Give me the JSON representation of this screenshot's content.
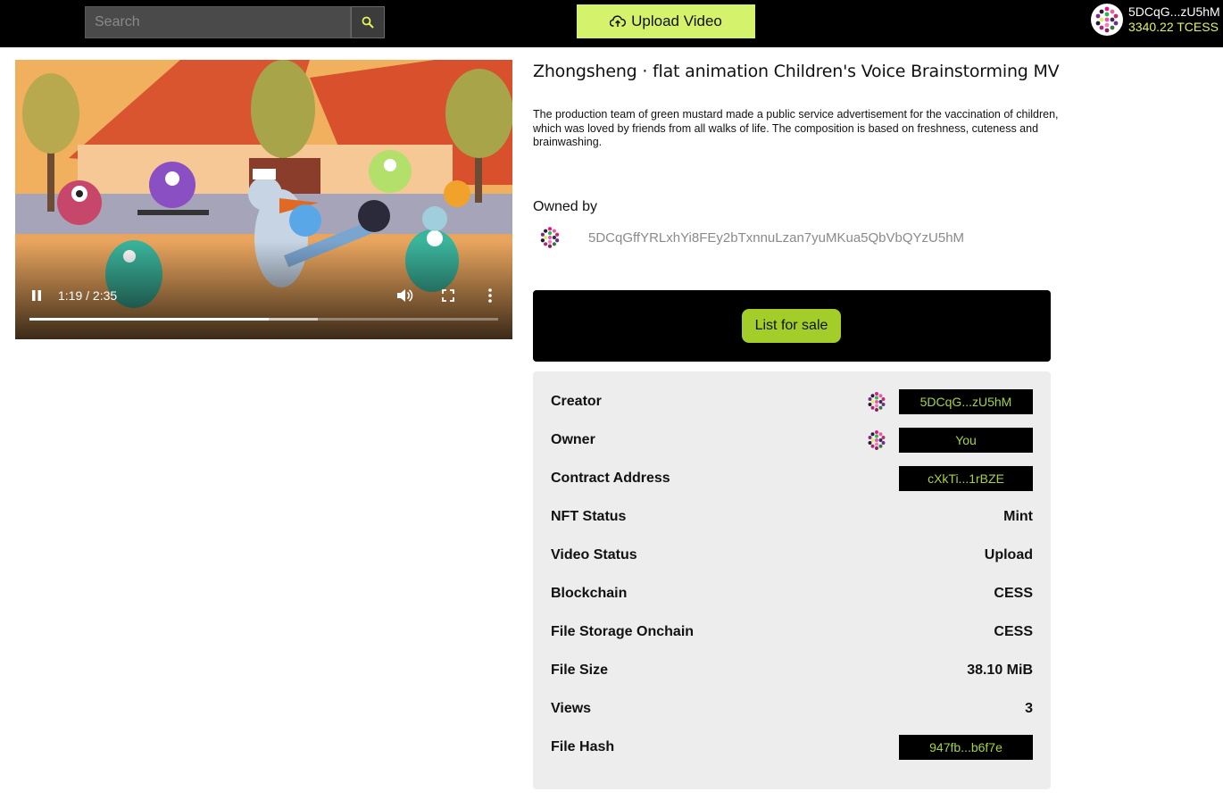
{
  "header": {
    "search_placeholder": "Search",
    "upload_label": "Upload Video",
    "account_address": "5DCqG...zU5hM",
    "account_balance": "3340.22 TCESS"
  },
  "video": {
    "time": "1:19 / 2:35",
    "progress_fraction": 0.51,
    "buffered_fraction": 0.615
  },
  "nft": {
    "title": "Zhongsheng · flat animation Children's Voice Brainstorming MV",
    "description": "The production team of green mustard made a public service advertisement for the vaccination of children, which was loved by friends from all walks of life. The composition is based on freshness, cuteness and brainwashing.",
    "owned_by_label": "Owned by",
    "owner_full_address": "5DCqGffYRLxhYi8FEy2bTxnnuLzan7yuMKua5QbVbQYzU5hM",
    "list_for_sale_label": "List for sale"
  },
  "details": [
    {
      "label": "Creator",
      "value": "5DCqG...zU5hM",
      "kind": "pill-avatar"
    },
    {
      "label": "Owner",
      "value": "You",
      "kind": "pill-avatar"
    },
    {
      "label": "Contract Address",
      "value": "cXkTi...1rBZE",
      "kind": "pill"
    },
    {
      "label": "NFT Status",
      "value": "Mint",
      "kind": "text"
    },
    {
      "label": "Video Status",
      "value": "Upload",
      "kind": "text"
    },
    {
      "label": "Blockchain",
      "value": "CESS",
      "kind": "text"
    },
    {
      "label": "File Storage Onchain",
      "value": "CESS",
      "kind": "text"
    },
    {
      "label": "File Size",
      "value": "38.10 MiB",
      "kind": "text"
    },
    {
      "label": "Views",
      "value": "3",
      "kind": "text"
    },
    {
      "label": "File Hash",
      "value": "947fb...b6f7e",
      "kind": "pill"
    }
  ],
  "colors": {
    "accent_yellow": "#d4f26b",
    "sale_button": "#a3ce2a",
    "pill_text": "#a6d33c",
    "balance": "#e6f35a"
  },
  "icons": {
    "search": "search-icon",
    "upload": "cloud-upload-icon",
    "pause": "pause-icon",
    "volume": "volume-icon",
    "fullscreen": "fullscreen-icon",
    "more": "more-vertical-icon",
    "identicon": "identicon-avatar"
  }
}
